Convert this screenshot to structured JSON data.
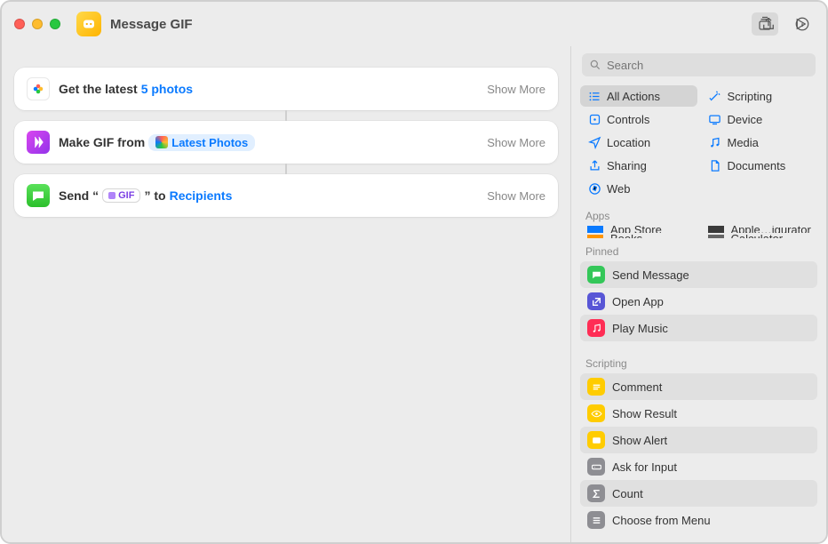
{
  "window": {
    "title": "Message GIF"
  },
  "actions": [
    {
      "icon": "photos",
      "icon_bg": "#fff",
      "segments": [
        {
          "t": "plain",
          "v": "Get the latest"
        },
        {
          "t": "param-blue",
          "v": "5 photos"
        }
      ],
      "show_more": "Show More"
    },
    {
      "icon": "shortcuts",
      "icon_bg": "linear-gradient(135deg,#d946ef,#9333ea)",
      "segments": [
        {
          "t": "plain",
          "v": "Make GIF from"
        },
        {
          "t": "param-tag",
          "v": "Latest Photos",
          "tag_icon": "photos-mini"
        }
      ],
      "show_more": "Show More"
    },
    {
      "icon": "messages",
      "icon_bg": "linear-gradient(180deg,#5ae15a,#2bbf2b)",
      "segments": [
        {
          "t": "plain",
          "v": "Send “"
        },
        {
          "t": "gif-badge",
          "v": "GIF"
        },
        {
          "t": "plain",
          "v": "” to"
        },
        {
          "t": "param-blue",
          "v": "Recipients"
        }
      ],
      "show_more": "Show More"
    }
  ],
  "search": {
    "placeholder": "Search"
  },
  "categories": [
    {
      "label": "All Actions",
      "icon": "list",
      "color": "#0a7aff",
      "selected": true
    },
    {
      "label": "Scripting",
      "icon": "wand",
      "color": "#0a7aff"
    },
    {
      "label": "Controls",
      "icon": "square-dot",
      "color": "#0a7aff"
    },
    {
      "label": "Device",
      "icon": "device",
      "color": "#0a7aff"
    },
    {
      "label": "Location",
      "icon": "nav",
      "color": "#0a7aff"
    },
    {
      "label": "Media",
      "icon": "music",
      "color": "#0a7aff"
    },
    {
      "label": "Sharing",
      "icon": "share-up",
      "color": "#0a7aff"
    },
    {
      "label": "Documents",
      "icon": "doc",
      "color": "#0a7aff"
    },
    {
      "label": "Web",
      "icon": "compass",
      "color": "#0a7aff"
    }
  ],
  "sections": {
    "apps_label": "Apps",
    "apps": [
      {
        "label": "App Store",
        "color": "#0a7aff"
      },
      {
        "label": "Apple…igurator",
        "color": "#3a3a3a"
      },
      {
        "label": "Books",
        "color": "#ff9500"
      },
      {
        "label": "Calculator",
        "color": "#666"
      }
    ],
    "pinned_label": "Pinned",
    "pinned": [
      {
        "label": "Send Message",
        "color": "#34c759",
        "icon": "bubble"
      },
      {
        "label": "Open App",
        "color": "#5856d6",
        "icon": "open"
      },
      {
        "label": "Play Music",
        "color": "#ff2d55",
        "icon": "music"
      }
    ],
    "scripting_label": "Scripting",
    "scripting": [
      {
        "label": "Comment",
        "color": "#ffcc00",
        "icon": "lines"
      },
      {
        "label": "Show Result",
        "color": "#ffcc00",
        "icon": "eye"
      },
      {
        "label": "Show Alert",
        "color": "#ffcc00",
        "icon": "alert"
      },
      {
        "label": "Ask for Input",
        "color": "#8e8e93",
        "icon": "input"
      },
      {
        "label": "Count",
        "color": "#8e8e93",
        "icon": "sigma"
      },
      {
        "label": "Choose from Menu",
        "color": "#8e8e93",
        "icon": "menu"
      }
    ]
  }
}
